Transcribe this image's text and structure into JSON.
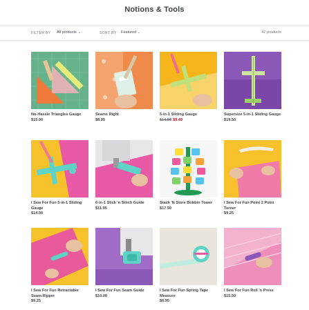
{
  "page": {
    "title": "Notions & Tools"
  },
  "filters": {
    "filter_by_label": "FILTER BY",
    "filter_by_value": "All products",
    "sort_by_label": "SORT BY",
    "sort_by_value": "Featured",
    "count": "41 products"
  },
  "products": [
    {
      "title": "No-Hassle Triangles Gauge",
      "price": "$15.00",
      "thumb_bg": "#66b28a"
    },
    {
      "title": "Seams Right",
      "price": "$8.95",
      "thumb_bg": "#f08a4b"
    },
    {
      "title": "5-in-1 Sliding Gauge",
      "price_old": "$14.50",
      "price_sale": "$9.49",
      "thumb_bg": "#f5b51b"
    },
    {
      "title": "Supersize 5-in-1 Sliding Gauge",
      "price": "$19.50",
      "thumb_bg": "#7a47a8"
    },
    {
      "title": "I Sew For Fun 5-in-1 Sliding Gauge",
      "price": "$14.50",
      "thumb_bg": "#f6c12a"
    },
    {
      "title": "6-in-1 Stick 'n Stitch Guide",
      "price": "$11.95",
      "thumb_bg": "#e85aa5"
    },
    {
      "title": "Stack 'N Store Bobbin Tower",
      "price": "$17.50",
      "thumb_bg": "#f7f7f7"
    },
    {
      "title": "I Sew For Fun Point 2 Point Turner",
      "price": "$9.25",
      "thumb_bg": "#f6c12a"
    },
    {
      "title": "I Sew For Fun Retractable Seam Ripper",
      "price": "$9.25",
      "thumb_bg": "#f6c12a"
    },
    {
      "title": "I Sew For Fun Seam Guide",
      "price": "$10.00",
      "thumb_bg": "#a06cc8"
    },
    {
      "title": "I Sew For Fun Spring Tape Measure",
      "price": "$6.95",
      "thumb_bg": "#e9e4dc"
    },
    {
      "title": "I Sew For Fun Roll 'n Press",
      "price": "$15.50",
      "thumb_bg": "#f3b3cf"
    }
  ]
}
